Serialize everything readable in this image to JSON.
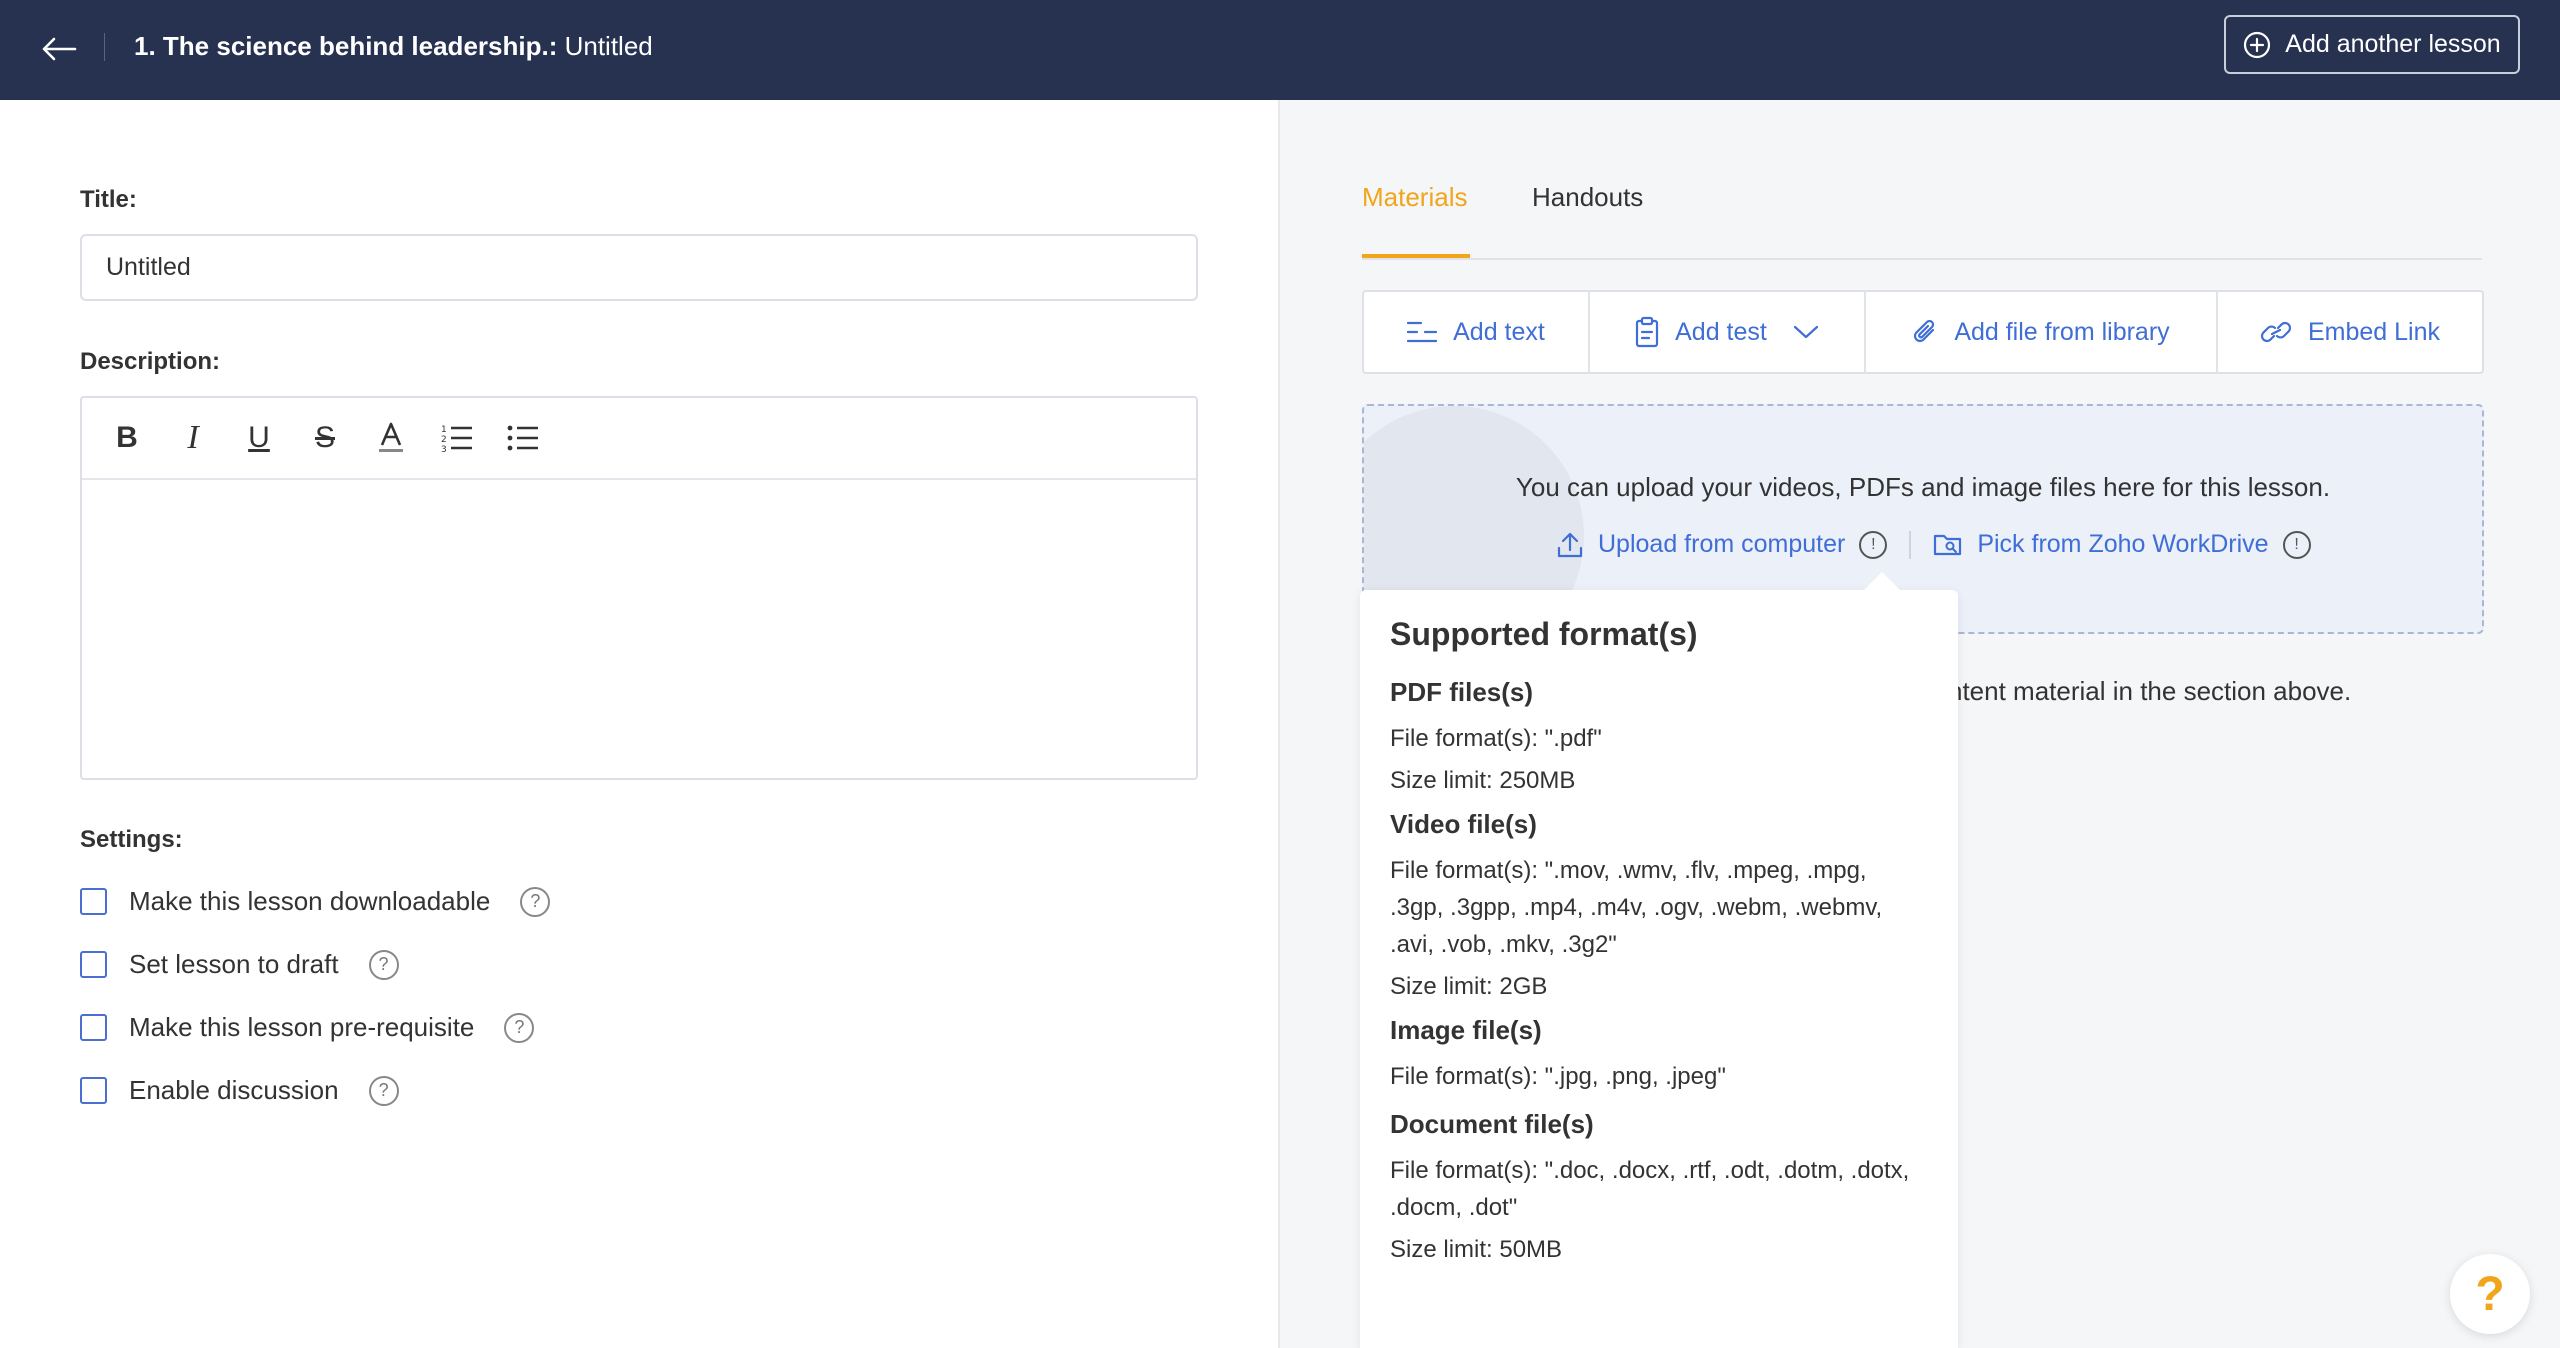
{
  "header": {
    "course_title": "1. The science behind leadership.:",
    "lesson_title": " Untitled",
    "add_lesson_label": "Add another lesson"
  },
  "form": {
    "title_label": "Title:",
    "title_value": "Untitled",
    "description_label": "Description:",
    "toolbar": {
      "bold": "B",
      "italic": "I",
      "underline": "U",
      "strike": "S",
      "font_color": "A"
    },
    "settings_label": "Settings:",
    "settings": [
      {
        "label": "Make this lesson downloadable",
        "checked": false
      },
      {
        "label": "Set lesson to draft",
        "checked": false
      },
      {
        "label": "Make this lesson pre-requisite",
        "checked": false
      },
      {
        "label": "Enable discussion",
        "checked": false
      }
    ],
    "help_glyph": "?"
  },
  "materials": {
    "tabs": [
      {
        "label": "Materials",
        "active": true
      },
      {
        "label": "Handouts",
        "active": false
      }
    ],
    "actions": {
      "add_text": "Add text",
      "add_test": "Add test",
      "add_file": "Add file from library",
      "embed_link": "Embed Link"
    },
    "upload_text": "You can upload your videos, PDFs and image files here for this lesson.",
    "upload_computer": "Upload from computer",
    "pick_workdrive": "Pick from Zoho WorkDrive",
    "info_glyph": "!",
    "info_text": "ntent material in the section above."
  },
  "tooltip": {
    "title": "Supported format(s)",
    "sections": [
      {
        "heading": "PDF files(s)",
        "lines": [
          "File format(s): \".pdf\""
        ],
        "size": "Size limit: 250MB"
      },
      {
        "heading": "Video file(s)",
        "lines": [
          "File format(s): \".mov, .wmv, .flv, .mpeg, .mpg,",
          ".3gp, .3gpp, .mp4, .m4v, .ogv, .webm, .webmv,",
          ".avi, .vob, .mkv, .3g2\""
        ],
        "size": "Size limit: 2GB"
      },
      {
        "heading": "Image file(s)",
        "lines": [
          "File format(s): \".jpg, .png, .jpeg\""
        ],
        "size": ""
      },
      {
        "heading": "Document file(s)",
        "lines": [
          "File format(s): \".doc, .docx, .rtf, .odt, .dotm, .dotx,",
          ".docm, .dot\""
        ],
        "size": "Size limit: 50MB"
      }
    ]
  },
  "help_fab": "?",
  "colors": {
    "header_bg": "#273251",
    "accent_orange": "#f0a51a",
    "link_blue": "#3f6ed6"
  }
}
